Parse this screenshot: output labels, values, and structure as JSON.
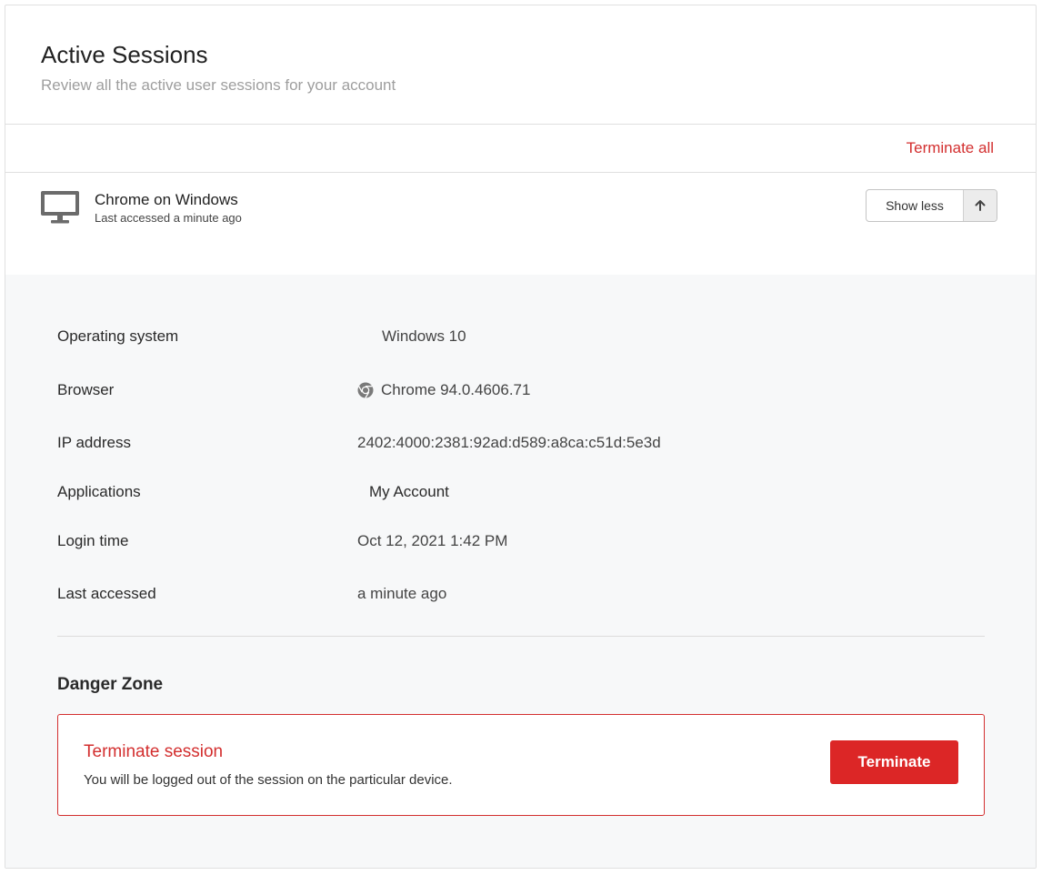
{
  "header": {
    "title": "Active Sessions",
    "subtitle": "Review all the active user sessions for your account"
  },
  "actions": {
    "terminate_all_label": "Terminate all"
  },
  "session": {
    "name": "Chrome on Windows",
    "meta": "Last accessed a minute ago",
    "toggle_label": "Show less",
    "icon": "monitor-icon"
  },
  "details": {
    "os": {
      "label": "Operating system",
      "value": "Windows 10"
    },
    "browser": {
      "label": "Browser",
      "value": "Chrome 94.0.4606.71",
      "icon": "chrome-icon"
    },
    "ip": {
      "label": "IP address",
      "value": "2402:4000:2381:92ad:d589:a8ca:c51d:5e3d"
    },
    "applications": {
      "label": "Applications",
      "value": "My Account"
    },
    "login_time": {
      "label": "Login time",
      "value": "Oct 12, 2021 1:42 PM"
    },
    "last_accessed": {
      "label": "Last accessed",
      "value": "a minute ago"
    }
  },
  "danger_zone": {
    "title": "Danger Zone",
    "heading": "Terminate session",
    "description": "You will be logged out of the session on the particular device.",
    "button_label": "Terminate"
  },
  "colors": {
    "danger": "#d32f2f",
    "button_danger": "#dc2626",
    "details_bg": "#f7f8f9"
  }
}
